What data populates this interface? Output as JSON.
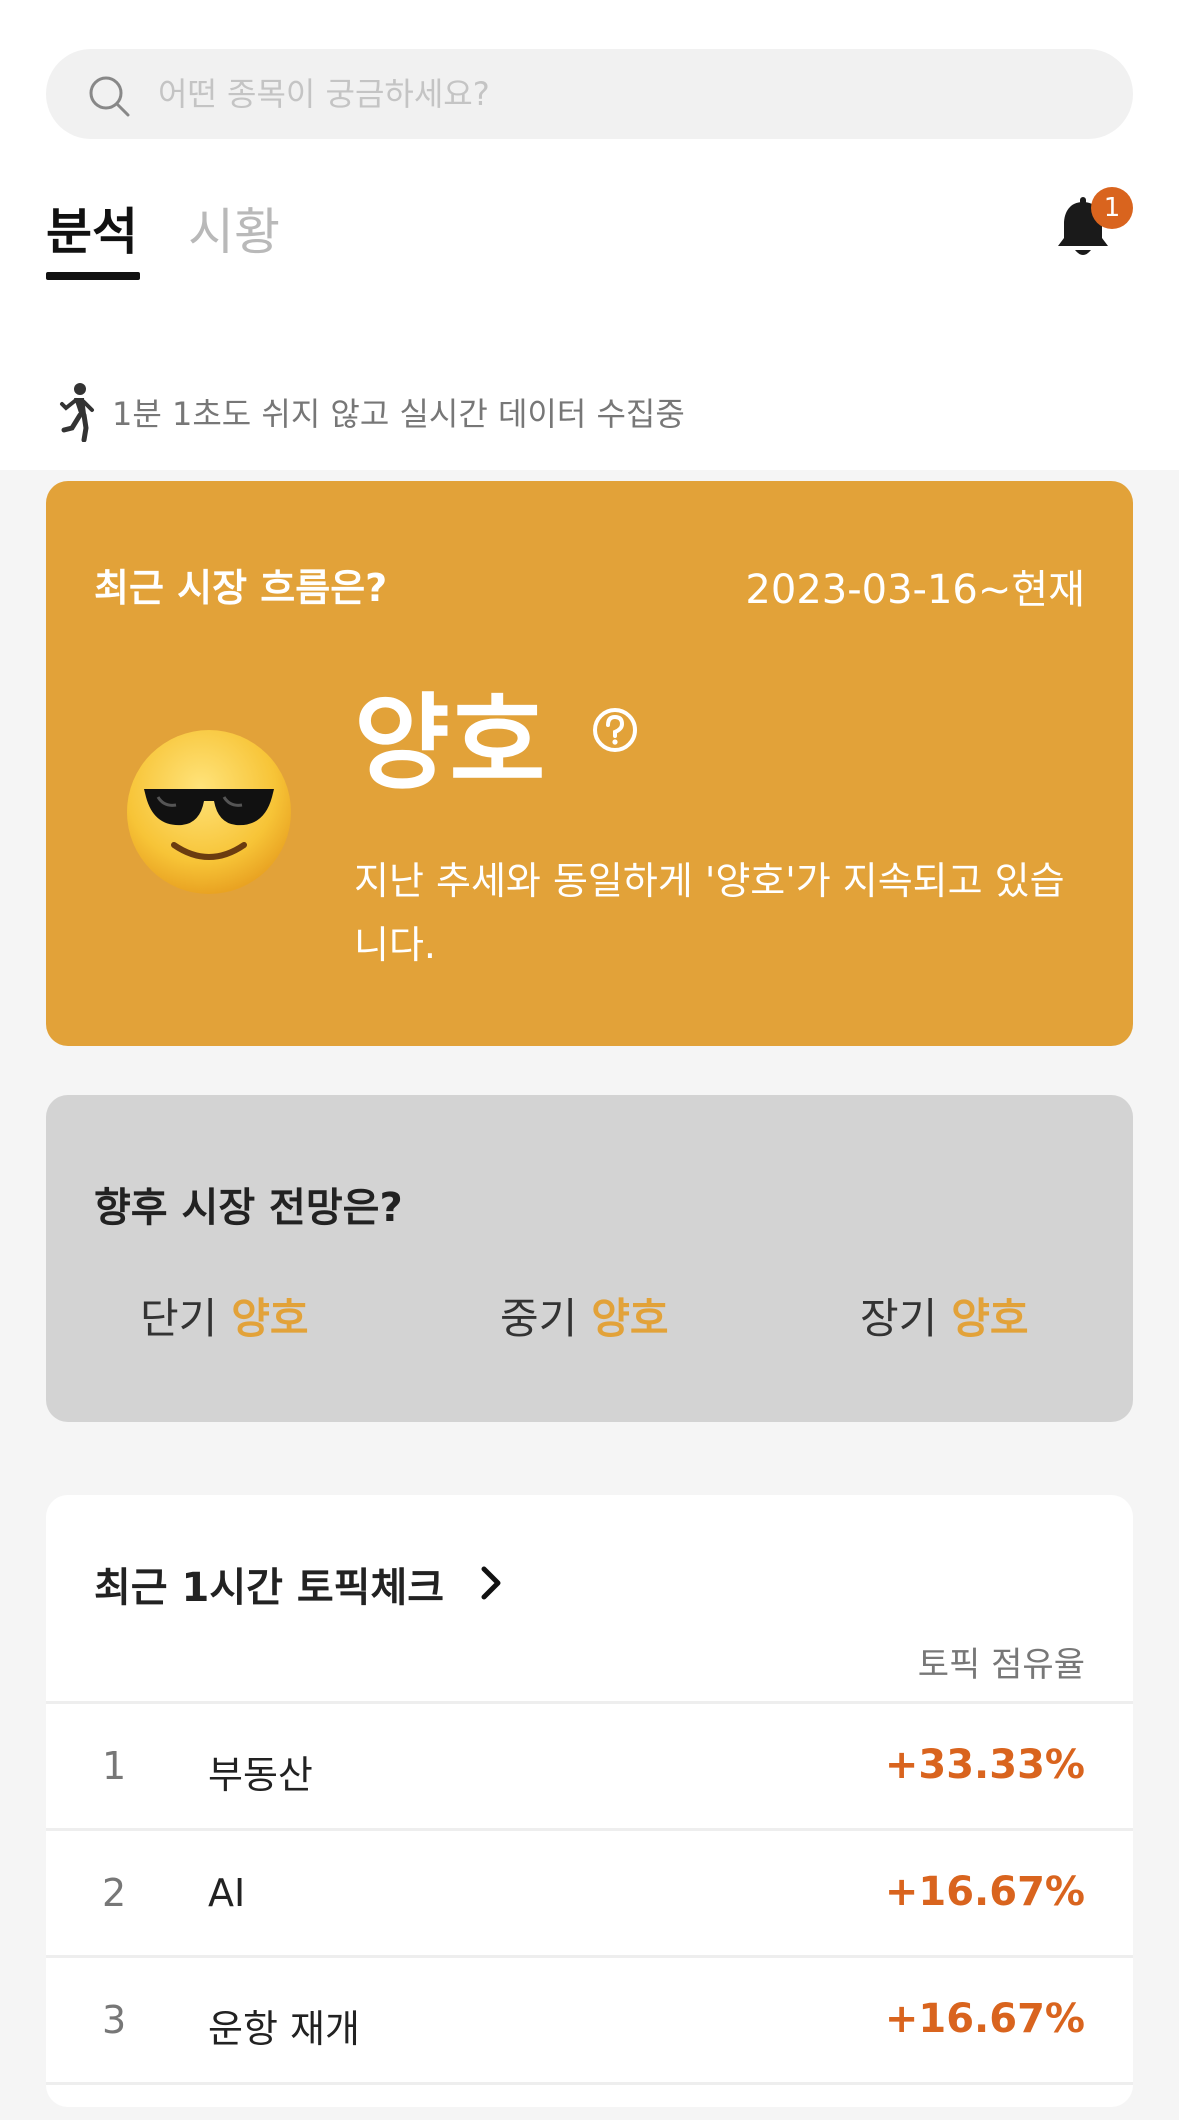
{
  "search": {
    "placeholder": "어떤 종목이 궁금하세요?"
  },
  "tabs": [
    {
      "label": "분석",
      "active": true
    },
    {
      "label": "시황",
      "active": false
    }
  ],
  "notifications": {
    "count": "1"
  },
  "collect_status": "1분 1초도 쉬지 않고 실시간 데이터 수집중",
  "trend": {
    "title": "최근 시장 흐름은?",
    "period": "2023-03-16~현재",
    "status": "양호",
    "description": "지난 추세와 동일하게 '양호'가 지속되고 있습니다."
  },
  "outlook": {
    "title": "향후 시장 전망은?",
    "items": [
      {
        "term": "단기",
        "value": "양호"
      },
      {
        "term": "중기",
        "value": "양호"
      },
      {
        "term": "장기",
        "value": "양호"
      }
    ]
  },
  "topics": {
    "title": "최근 1시간 토픽체크",
    "column_header": "토픽 점유율",
    "rows": [
      {
        "rank": "1",
        "name": "부동산",
        "share": "+33.33%"
      },
      {
        "rank": "2",
        "name": "AI",
        "share": "+16.67%"
      },
      {
        "rank": "3",
        "name": "운항 재개",
        "share": "+16.67%"
      }
    ]
  },
  "colors": {
    "accent_orange": "#e2a239",
    "highlight_red": "#d9641e",
    "outlook_bg": "#d3d3d3"
  }
}
